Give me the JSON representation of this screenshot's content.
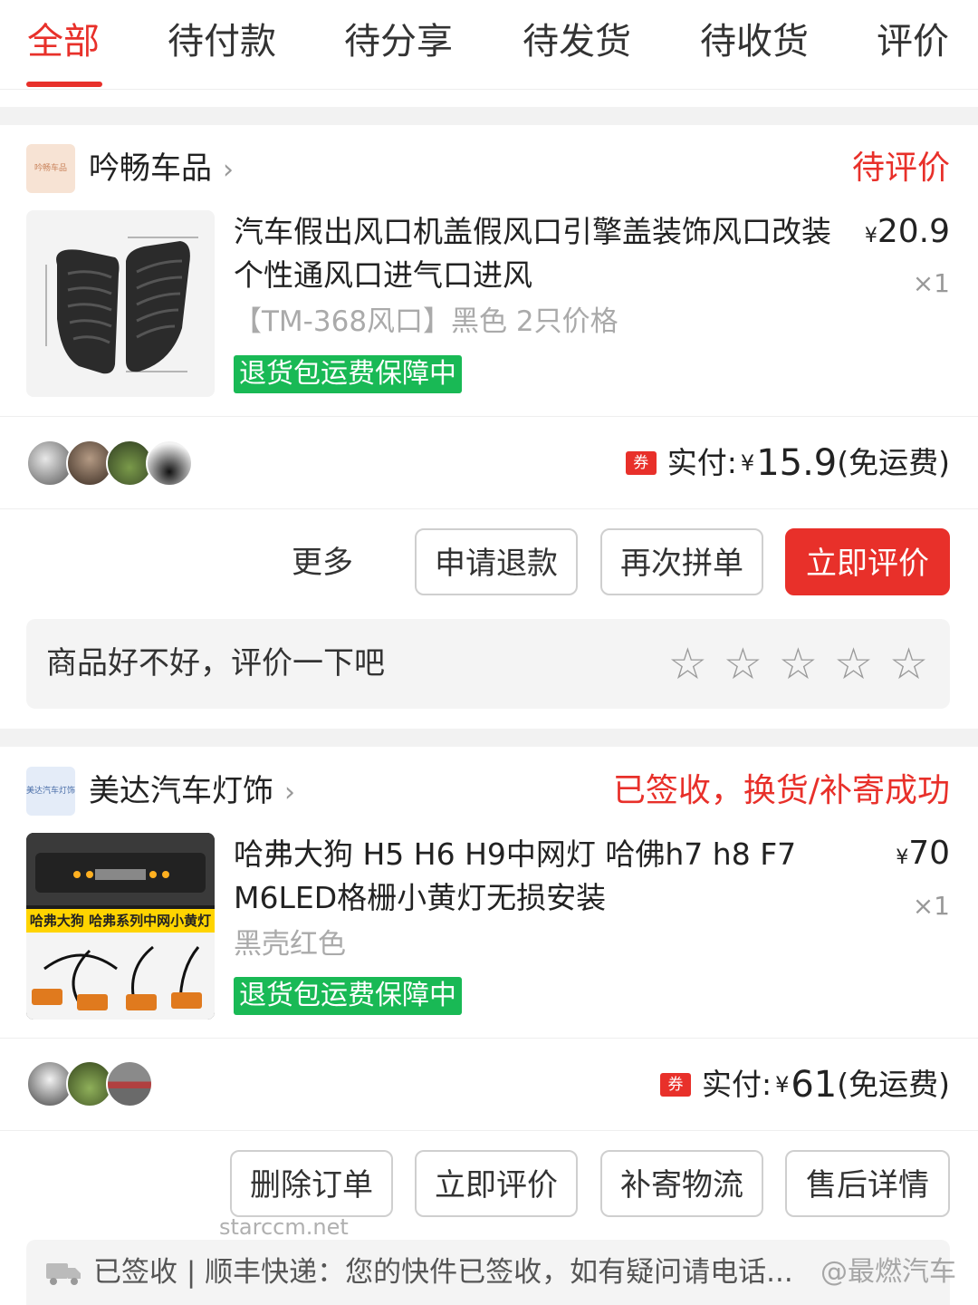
{
  "tabs": [
    "全部",
    "待付款",
    "待分享",
    "待发货",
    "待收货",
    "评价"
  ],
  "orders": [
    {
      "shop": {
        "logo_text": "吟畅车品",
        "name": "吟畅车品"
      },
      "status": "待评价",
      "product": {
        "title": "汽车假出风口机盖假风口引擎盖装饰风口改装个性通风口进气口进风",
        "spec": "【TM-368风口】黑色 2只价格",
        "badge": "退货包运费保障中",
        "currency": "¥",
        "price": "20.9",
        "qty": "×1"
      },
      "paid": {
        "coupon": "券",
        "label": "实付:",
        "currency": "¥",
        "amount": "15.9",
        "note": "(免运费)"
      },
      "actions": {
        "more": "更多",
        "btn1": "申请退款",
        "btn2": "再次拼单",
        "btn3": "立即评价"
      },
      "review": {
        "prompt": "商品好不好，评价一下吧",
        "stars": 5
      }
    },
    {
      "shop": {
        "logo_text": "美达汽车灯饰",
        "name": "美达汽车灯饰"
      },
      "status": "已签收，换货/补寄成功",
      "product": {
        "title": "哈弗大狗 H5 H6 H9中网灯 哈佛h7 h8 F7 M6LED格栅小黄灯无损安装",
        "spec": "黑壳红色",
        "badge": "退货包运费保障中",
        "image_text": "哈弗大狗 哈弗系列中网小黄灯",
        "currency": "¥",
        "price": "70",
        "qty": "×1"
      },
      "paid": {
        "coupon": "券",
        "label": "实付:",
        "currency": "¥",
        "amount": "61",
        "note": "(免运费)"
      },
      "actions": {
        "btn1": "删除订单",
        "btn2": "立即评价",
        "btn3": "补寄物流",
        "btn4": "售后详情"
      },
      "logistics": "已签收 | 顺丰快递：您的快件已签收，如有疑问请电话..."
    }
  ],
  "watermarks": {
    "site": "starccm.net",
    "author": "@最燃汽车"
  },
  "colors": {
    "accent": "#e8302a",
    "badge": "#19b955",
    "divider": "#f2f2f2"
  },
  "icons": [
    "chevron-right-icon",
    "coupon-icon",
    "star-outline-icon",
    "truck-icon"
  ]
}
